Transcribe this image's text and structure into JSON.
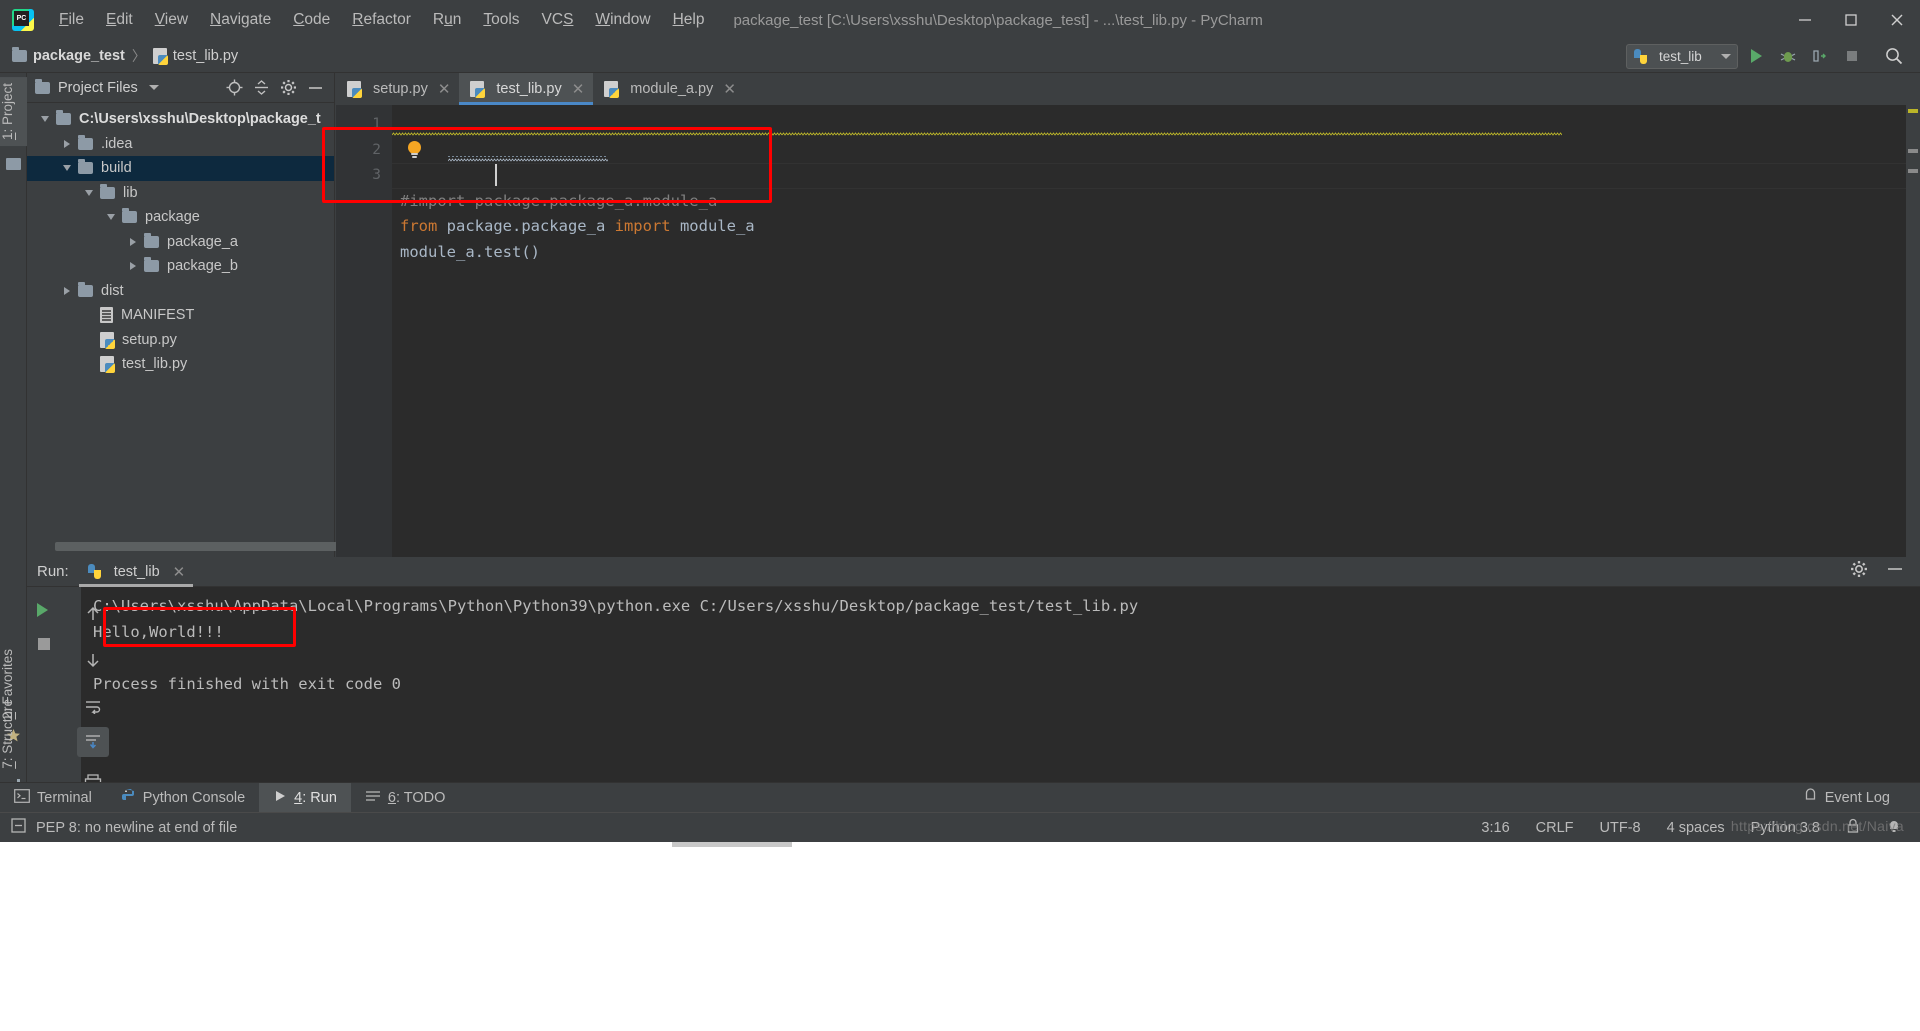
{
  "window": {
    "title": "package_test [C:\\Users\\xsshu\\Desktop\\package_test] - ...\\test_lib.py - PyCharm",
    "logo_text": "PC",
    "minimize": "—",
    "maximize": "▢",
    "close": "✕"
  },
  "menu": [
    {
      "label": "File",
      "mnemonic": "F"
    },
    {
      "label": "Edit",
      "mnemonic": "E"
    },
    {
      "label": "View",
      "mnemonic": "V"
    },
    {
      "label": "Navigate",
      "mnemonic": "N"
    },
    {
      "label": "Code",
      "mnemonic": "C"
    },
    {
      "label": "Refactor",
      "mnemonic": "R"
    },
    {
      "label": "Run",
      "mnemonic": "u"
    },
    {
      "label": "Tools",
      "mnemonic": "T"
    },
    {
      "label": "VCS",
      "mnemonic": "S"
    },
    {
      "label": "Window",
      "mnemonic": "W"
    },
    {
      "label": "Help",
      "mnemonic": "H"
    }
  ],
  "navbar": {
    "breadcrumb": [
      {
        "label": "package_test",
        "icon": "folder-icon"
      },
      {
        "label": "test_lib.py",
        "icon": "python-file-icon"
      }
    ],
    "separator": "〉",
    "run_config": "test_lib",
    "actions": [
      "run-icon",
      "debug-icon",
      "run-coverage-icon",
      "stop-icon",
      "search-icon"
    ]
  },
  "left_tool_strip": [
    {
      "label": "1: Project",
      "mnemonic": "1",
      "selected": true
    },
    {
      "label": "2: Favorites",
      "mnemonic": "2",
      "selected": false
    },
    {
      "label": "7: Structure",
      "mnemonic": "7",
      "selected": false
    }
  ],
  "project_panel": {
    "title": "Project Files",
    "tools": [
      "locate-icon",
      "collapse-all-icon",
      "settings-gear-icon",
      "hide-icon"
    ],
    "tree": [
      {
        "label": "C:\\Users\\xsshu\\Desktop\\package_t",
        "depth": 0,
        "state": "expanded",
        "icon": "folder-icon",
        "root": true,
        "selected": false
      },
      {
        "label": ".idea",
        "depth": 1,
        "state": "collapsed",
        "icon": "folder-icon",
        "selected": false
      },
      {
        "label": "build",
        "depth": 1,
        "state": "expanded",
        "icon": "folder-icon",
        "selected": true
      },
      {
        "label": "lib",
        "depth": 2,
        "state": "expanded",
        "icon": "folder-icon",
        "selected": false
      },
      {
        "label": "package",
        "depth": 3,
        "state": "expanded",
        "icon": "folder-icon",
        "selected": false
      },
      {
        "label": "package_a",
        "depth": 4,
        "state": "collapsed",
        "icon": "folder-icon",
        "selected": false
      },
      {
        "label": "package_b",
        "depth": 4,
        "state": "collapsed",
        "icon": "folder-icon",
        "selected": false
      },
      {
        "label": "dist",
        "depth": 1,
        "state": "collapsed",
        "icon": "folder-icon",
        "selected": false
      },
      {
        "label": "MANIFEST",
        "depth": 2,
        "state": "leaf",
        "icon": "manifest-file-icon",
        "selected": false
      },
      {
        "label": "setup.py",
        "depth": 2,
        "state": "leaf",
        "icon": "python-file-icon",
        "selected": false
      },
      {
        "label": "test_lib.py",
        "depth": 2,
        "state": "leaf",
        "icon": "python-file-icon",
        "selected": false
      }
    ]
  },
  "editor": {
    "tabs": [
      {
        "label": "setup.py",
        "active": false,
        "icon": "python-file-icon"
      },
      {
        "label": "test_lib.py",
        "active": true,
        "icon": "python-file-icon"
      },
      {
        "label": "module_a.py",
        "active": false,
        "icon": "python-file-icon"
      }
    ],
    "close_glyph": "✕",
    "line_numbers": [
      "1",
      "2",
      "3"
    ],
    "lines": [
      {
        "n": 1,
        "segments": [
          {
            "t": "#import package.package_a.module_a",
            "c": "cm"
          }
        ]
      },
      {
        "n": 2,
        "segments": [
          {
            "t": "from",
            "c": "kw"
          },
          {
            "t": " package.package_a ",
            "c": "id"
          },
          {
            "t": "import",
            "c": "kw"
          },
          {
            "t": " module_a",
            "c": "id"
          }
        ]
      },
      {
        "n": 3,
        "segments": [
          {
            "t": "module_a.test",
            "c": "id"
          },
          {
            "t": "()",
            "c": "paren"
          }
        ]
      }
    ],
    "intention_bulb": "intention-bulb-icon",
    "annotation": "red-highlight-box"
  },
  "run_panel": {
    "label": "Run:",
    "tab_label": "test_lib",
    "tab_icon": "python-run-config-icon",
    "close_glyph": "✕",
    "header_actions": [
      "settings-gear-icon",
      "hide-panel-icon"
    ],
    "sidebar_actions": [
      "rerun-icon",
      "stop-icon",
      "up-icon",
      "down-icon",
      "soft-wrap-icon",
      "scroll-to-end-icon",
      "print-icon",
      "more-icon"
    ],
    "console_lines": [
      {
        "text": "C:\\Users\\xsshu\\AppData\\Local\\Programs\\Python\\Python39\\python.exe C:/Users/xsshu/Desktop/package_test/test_lib.py",
        "highlight": false
      },
      {
        "text": "Hello,World!!!",
        "highlight": true
      },
      {
        "text": "",
        "highlight": false
      },
      {
        "text": "Process finished with exit code 0",
        "highlight": false
      }
    ]
  },
  "bottom_bar": {
    "items": [
      {
        "label": "Terminal",
        "icon": "terminal-icon",
        "selected": false,
        "mnemonic": ""
      },
      {
        "label": "Python Console",
        "icon": "python-console-icon",
        "selected": false,
        "mnemonic": ""
      },
      {
        "label": "4: Run",
        "icon": "run-icon",
        "selected": true,
        "mnemonic": "4"
      },
      {
        "label": "6: TODO",
        "icon": "todo-icon",
        "selected": false,
        "mnemonic": "6"
      }
    ],
    "event_log": "Event Log",
    "event_log_icon": "event-log-icon"
  },
  "status_bar": {
    "message": "PEP 8: no newline at end of file",
    "message_icon": "inspection-icon",
    "caret_position": "3:16",
    "line_separator": "CRLF",
    "encoding": "UTF-8",
    "indent": "4 spaces",
    "interpreter": "Python 3.8",
    "lock_icon": "lock-icon",
    "notification_icon": "notification-icon"
  },
  "watermark": "https://blog.csdn.net/Naiva",
  "colors": {
    "accent_blue": "#4a88c7",
    "annotation_red": "#ff0000",
    "selection_blue": "#0d293e",
    "keyword_orange": "#cc7832",
    "function_yellow": "#ffc66d",
    "comment_gray": "#808080",
    "panel_bg": "#3c3f41",
    "editor_bg": "#2b2b2b",
    "run_green": "#59a869"
  }
}
